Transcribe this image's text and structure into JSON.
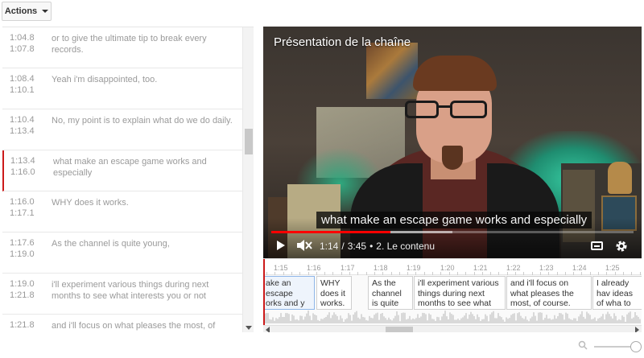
{
  "toolbar": {
    "actions_label": "Actions"
  },
  "captions": [
    {
      "start": "1:04.8",
      "end": "1:07.8",
      "text": "or to give the ultimate tip to break every records."
    },
    {
      "start": "1:08.4",
      "end": "1:10.1",
      "text": "Yeah i'm disappointed, too."
    },
    {
      "start": "1:10.4",
      "end": "1:13.4",
      "text": "No, my point is to explain what do we do daily."
    },
    {
      "start": "1:13.4",
      "end": "1:16.0",
      "text": "what make an escape game works and especially"
    },
    {
      "start": "1:16.0",
      "end": "1:17.1",
      "text": "WHY does it works."
    },
    {
      "start": "1:17.6",
      "end": "1:19.0",
      "text": "As the channel is quite young,"
    },
    {
      "start": "1:19.0",
      "end": "1:21.8",
      "text": "i'll experiment various things during next months to see what interests you or not"
    },
    {
      "start": "1:21.8",
      "end": "",
      "text": "and i'll focus on what pleases the most, of"
    }
  ],
  "player": {
    "title": "Présentation de la chaîne",
    "subtitle": "what make an escape game works and especially",
    "current_time": "1:14",
    "duration": "3:45",
    "chapter": "2. Le contenu",
    "progress": 0.329,
    "buffered": 0.5
  },
  "timeline": {
    "ticks": [
      "1:15",
      "1:16",
      "1:17",
      "1:18",
      "1:19",
      "1:20",
      "1:21",
      "1:22",
      "1:23",
      "1:24",
      "1:25"
    ],
    "blocks": [
      "ake an escape orks and y",
      "WHY does it works.",
      "As the channel is quite",
      "i'll experiment various things during next months to see what",
      "and i'll focus on what pleases the most, of course.",
      "I already hav ideas of wha to show you"
    ]
  },
  "colors": {
    "accent": "#cc1a1a",
    "progress": "#ff0000"
  }
}
